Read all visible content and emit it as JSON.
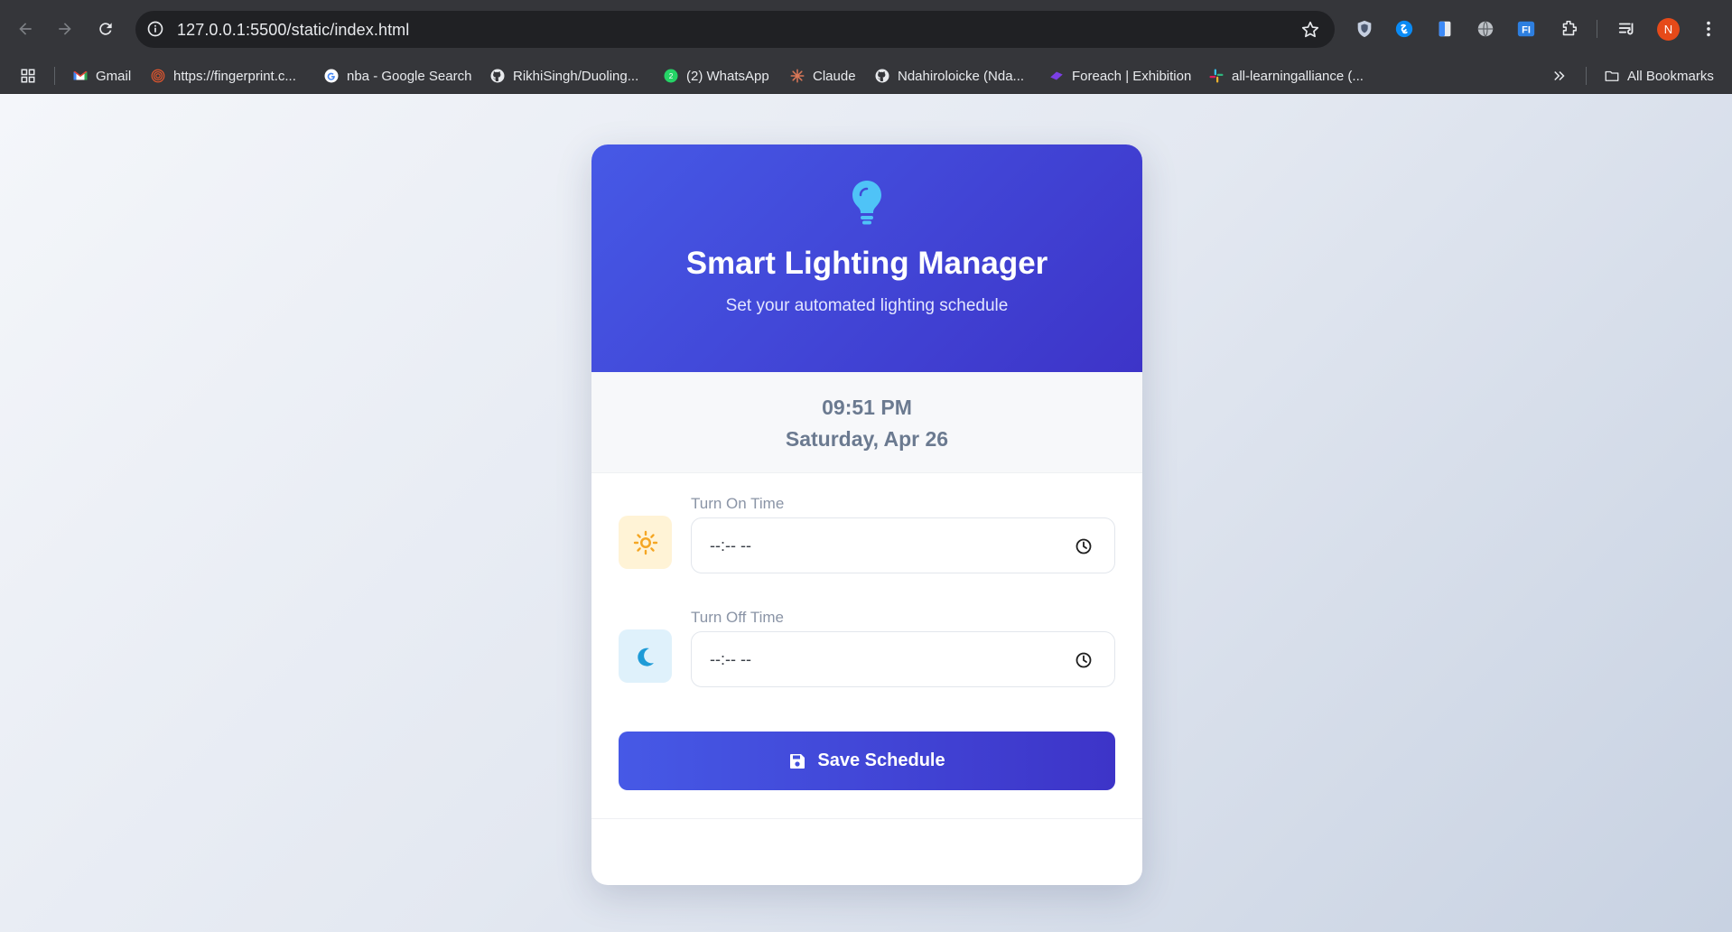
{
  "browser": {
    "url": "127.0.0.1:5500/static/index.html",
    "profile_initial": "N",
    "bookmarks": [
      {
        "label": "Gmail",
        "icon": "gmail-icon"
      },
      {
        "label": "https://fingerprint.c...",
        "icon": "fingerprint-icon"
      },
      {
        "label": "nba - Google Search",
        "icon": "google-icon"
      },
      {
        "label": "RikhiSingh/Duoling...",
        "icon": "github-icon"
      },
      {
        "label": "(2) WhatsApp",
        "icon": "whatsapp-icon"
      },
      {
        "label": "Claude",
        "icon": "claude-icon"
      },
      {
        "label": "Ndahiroloicke (Nda...",
        "icon": "github-icon"
      },
      {
        "label": "Foreach | Exhibition",
        "icon": "foreach-icon"
      },
      {
        "label": "all-learningalliance (...",
        "icon": "slack-icon"
      }
    ],
    "all_bookmarks_label": "All Bookmarks"
  },
  "app": {
    "title": "Smart Lighting Manager",
    "subtitle": "Set your automated lighting schedule",
    "current_time": "09:51 PM",
    "current_date": "Saturday, Apr 26",
    "on_time": {
      "label": "Turn On Time",
      "placeholder": "--:-- --",
      "icon": "sun-icon"
    },
    "off_time": {
      "label": "Turn Off Time",
      "placeholder": "--:-- --",
      "icon": "moon-icon"
    },
    "save_label": "Save Schedule"
  },
  "colors": {
    "header_start": "#4659e6",
    "header_end": "#3d34c8",
    "bulb": "#4fc3f7",
    "sun_badge_bg": "#fff3d6",
    "sun": "#f5a623",
    "moon_badge_bg": "#dff1fb",
    "moon": "#1e9bd7"
  }
}
